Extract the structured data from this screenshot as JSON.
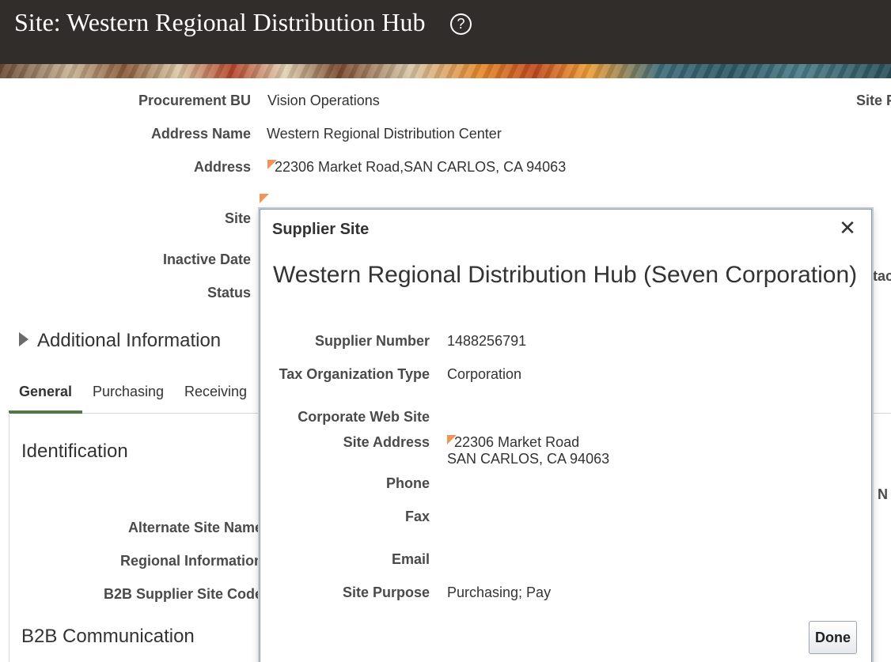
{
  "header": {
    "title": "Site: Western Regional Distribution Hub",
    "help_icon": "help-circle-icon"
  },
  "form": {
    "procurement_bu_label": "Procurement BU",
    "procurement_bu_value": "Vision Operations",
    "address_name_label": "Address Name",
    "address_name_value": "Western Regional Distribution Center",
    "address_label": "Address",
    "address_value": "22306 Market Road,SAN CARLOS, CA 94063",
    "site_label": "Site",
    "inactive_date_label": "Inactive Date",
    "status_label": "Status",
    "right_cut_label_1": "Site F",
    "right_cut_label_2": "tac",
    "right_cut_label_3": "r N"
  },
  "additional_info": {
    "title": "Additional Information"
  },
  "tabs": [
    {
      "label": "General",
      "active": true
    },
    {
      "label": "Purchasing",
      "active": false
    },
    {
      "label": "Receiving",
      "active": false
    }
  ],
  "general_panel": {
    "identification_title": "Identification",
    "alternate_site_name_label": "Alternate Site Name",
    "regional_information_label": "Regional Information",
    "b2b_site_code_label": "B2B Supplier Site Code",
    "b2b_communication_title": "B2B Communication"
  },
  "popup": {
    "title": "Supplier Site",
    "heading": "Western Regional Distribution Hub (Seven Corporation)",
    "close_icon": "close-icon",
    "supplier_number_label": "Supplier Number",
    "supplier_number_value": "1488256791",
    "tax_org_type_label": "Tax Organization Type",
    "tax_org_type_value": "Corporation",
    "corporate_web_site_label": "Corporate Web Site",
    "site_address_label": "Site Address",
    "site_address_line1": "22306 Market Road",
    "site_address_line2": "SAN CARLOS, CA 94063",
    "phone_label": "Phone",
    "fax_label": "Fax",
    "email_label": "Email",
    "site_purpose_label": "Site Purpose",
    "site_purpose_value": "Purchasing; Pay",
    "done_label": "Done"
  },
  "colors": {
    "header_bg": "#312d2a",
    "flag": "#f0955a",
    "tab_accent": "#4f7a44"
  }
}
